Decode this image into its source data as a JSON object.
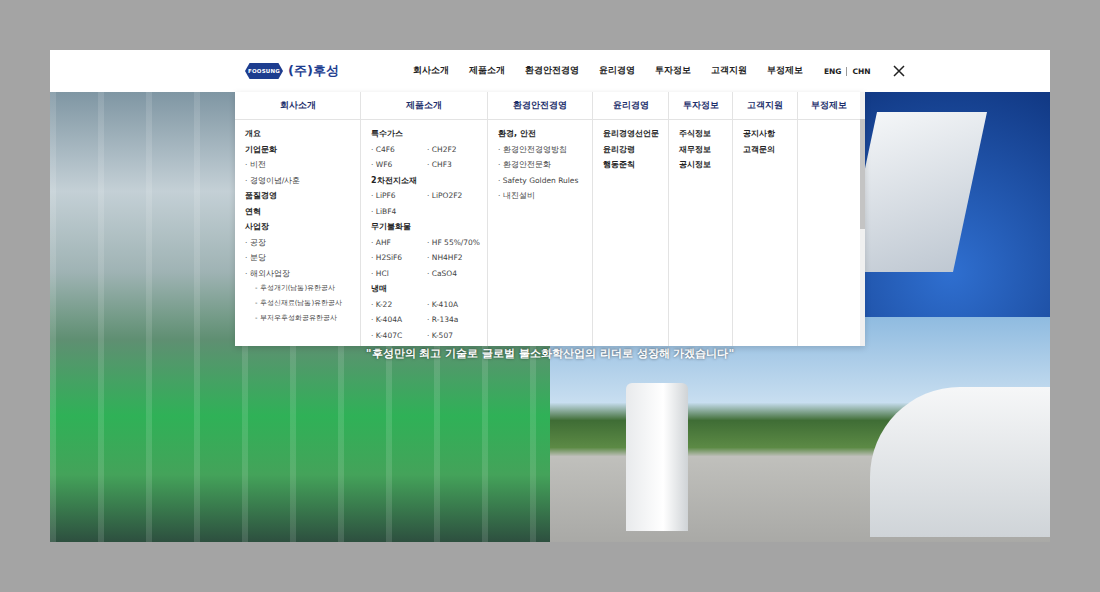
{
  "header": {
    "logo_mark": "FOOSUNG",
    "logo_text": "(주)후성",
    "nav": [
      "회사소개",
      "제품소개",
      "환경안전경영",
      "윤리경영",
      "투자정보",
      "고객지원",
      "부정제보"
    ],
    "languages": [
      "ENG",
      "CHN"
    ]
  },
  "mega_menu": {
    "columns": [
      {
        "title": "회사소개",
        "items": [
          {
            "kind": "head",
            "text": "개요"
          },
          {
            "kind": "head",
            "text": "기업문화"
          },
          {
            "kind": "sub",
            "text": "· 비전"
          },
          {
            "kind": "sub",
            "text": "· 경영이념/사훈"
          },
          {
            "kind": "head",
            "text": "품질경영"
          },
          {
            "kind": "head",
            "text": "연혁"
          },
          {
            "kind": "head",
            "text": "사업장"
          },
          {
            "kind": "sub",
            "text": "· 공장"
          },
          {
            "kind": "sub",
            "text": "· 분당"
          },
          {
            "kind": "sub",
            "text": "· 해외사업장"
          },
          {
            "kind": "subsub",
            "text": "- 후성개기(남통)유한공사"
          },
          {
            "kind": "subsub",
            "text": "- 후성신재료(남통)유한공사"
          },
          {
            "kind": "subsub",
            "text": "- 부저우후성화공유한공사"
          }
        ]
      },
      {
        "title": "제품소개",
        "items": [
          {
            "kind": "head",
            "text": "특수가스"
          },
          {
            "kind": "grid",
            "cells": [
              "· C4F6",
              "· CH2F2",
              "· WF6",
              "· CHF3"
            ]
          },
          {
            "kind": "head",
            "text": "2차전지소재"
          },
          {
            "kind": "grid",
            "cells": [
              "· LiPF6",
              "· LiPO2F2",
              "· LiBF4"
            ]
          },
          {
            "kind": "head",
            "text": "무기불화물"
          },
          {
            "kind": "grid",
            "cells": [
              "· AHF",
              "· HF 55%/70%",
              "· H2SiF6",
              "· NH4HF2",
              "· HCl",
              "· CaSO4"
            ]
          },
          {
            "kind": "head",
            "text": "냉매"
          },
          {
            "kind": "grid",
            "cells": [
              "· K-22",
              "· K-410A",
              "· K-404A",
              "· R-134a",
              "· K-407C",
              "· K-507"
            ]
          }
        ]
      },
      {
        "title": "환경안전경영",
        "items": [
          {
            "kind": "head",
            "text": "환경, 안전"
          },
          {
            "kind": "sub",
            "text": "· 환경안전경영방침"
          },
          {
            "kind": "sub",
            "text": "· 환경안전문화"
          },
          {
            "kind": "sub",
            "text": "· Safety Golden Rules"
          },
          {
            "kind": "sub",
            "text": "· 내진설비"
          }
        ]
      },
      {
        "title": "윤리경영",
        "items": [
          {
            "kind": "head",
            "text": "윤리경영선언문"
          },
          {
            "kind": "head",
            "text": "윤리강령"
          },
          {
            "kind": "head",
            "text": "행동준칙"
          }
        ]
      },
      {
        "title": "투자정보",
        "items": [
          {
            "kind": "head",
            "text": "주식정보"
          },
          {
            "kind": "head",
            "text": "재무정보"
          },
          {
            "kind": "head",
            "text": "공시정보"
          }
        ]
      },
      {
        "title": "고객지원",
        "items": [
          {
            "kind": "head",
            "text": "공지사항"
          },
          {
            "kind": "head",
            "text": "고객문의"
          }
        ]
      },
      {
        "title": "부정제보",
        "items": []
      }
    ]
  },
  "hero": {
    "quote": "\"후성만의 최고 기술로 글로벌 불소화학산업의 리더로 성장해 가겠습니다\""
  }
}
